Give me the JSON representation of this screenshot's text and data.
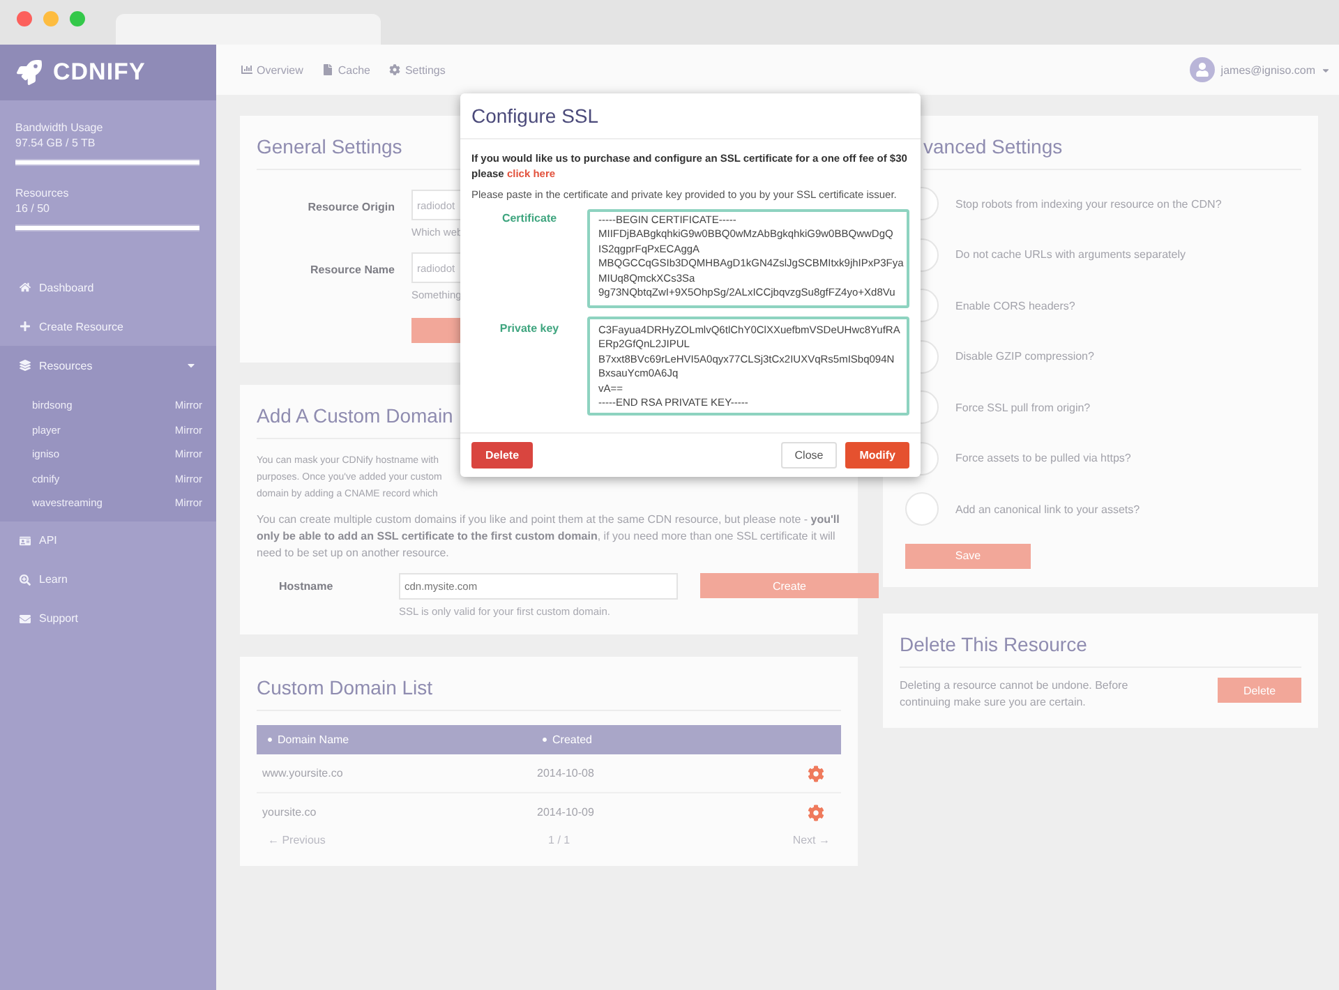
{
  "sidebar": {
    "logo": "CDNIFY",
    "meters": [
      {
        "label": "Bandwidth Usage",
        "reading": "97.54 GB / 5 TB",
        "level": 1
      },
      {
        "label": "Resources",
        "reading": "16 / 50",
        "level": 1
      }
    ],
    "items": [
      {
        "label": "Dashboard"
      },
      {
        "label": "Create Resource"
      },
      {
        "label": "Resources",
        "expanded": true,
        "children": [
          {
            "label": "birdsong",
            "badge": "Mirror"
          },
          {
            "label": "player",
            "badge": "Mirror"
          },
          {
            "label": "igniso",
            "badge": "Mirror"
          },
          {
            "label": "cdnify",
            "badge": "Mirror"
          },
          {
            "label": "wavestreaming",
            "badge": "Mirror"
          }
        ]
      },
      {
        "label": "API"
      },
      {
        "label": "Learn"
      },
      {
        "label": "Support"
      }
    ]
  },
  "topnav": {
    "tabs": [
      "Overview",
      "Cache",
      "Settings"
    ],
    "user": "james@igniso.com"
  },
  "general_settings": {
    "title": "General Settings",
    "fields": [
      {
        "label": "Resource Origin",
        "value": "radiodot",
        "hint": "Which web"
      },
      {
        "label": "Resource Name",
        "value": "radiodot",
        "hint": "Something"
      }
    ]
  },
  "custom_domain": {
    "title": "Add A Custom Domain",
    "lines": [
      "You can mask your CDNify hostname with",
      "purposes. Once you've added your custom",
      "domain by adding a CNAME record which"
    ],
    "note": "You can create multiple custom domains if you like and point them at the same CDN resource, but please note - **you'll only be able to add an SSL certificate to the first custom domain**, if you need more than one SSL certificate it will need to be set up on another resource.",
    "hostname": {
      "label": "Hostname",
      "placeholder": "cdn.mysite.com",
      "hint": "SSL is only valid for your first custom domain."
    },
    "button": "Create"
  },
  "domain_list": {
    "title": "Custom Domain List",
    "columns": [
      "Domain Name",
      "Created"
    ],
    "rows": [
      {
        "domain": "www.yoursite.co",
        "created": "2014-10-08"
      },
      {
        "domain": "yoursite.co",
        "created": "2014-10-09"
      }
    ],
    "pagination": {
      "previous": "← Previous",
      "page": "1 / 1",
      "next": "Next →"
    }
  },
  "advanced_settings": {
    "title": "vanced Settings",
    "options": [
      {
        "label": "Stop robots from indexing your resource on the CDN?",
        "on": false
      },
      {
        "label": "Do not cache URLs with arguments separately",
        "on": false
      },
      {
        "label": "Enable CORS headers?",
        "on": false
      },
      {
        "label": "Disable GZIP compression?",
        "on": false
      },
      {
        "label": "Force SSL pull from origin?",
        "on": false
      },
      {
        "label": "Force assets to be pulled via https?",
        "on": false
      },
      {
        "label": "Add an canonical link to your assets?",
        "on": false
      }
    ],
    "button": "Save"
  },
  "delete_resource": {
    "title": "Delete This Resource",
    "text": "Deleting a resource cannot be undone. Before continuing make sure you are certain.",
    "button": "Delete"
  },
  "modal": {
    "title": "Configure SSL",
    "intro": "If you would like us to purchase and configure an SSL certificate for a one off fee of $30 please",
    "link": "click here",
    "note": "Please paste in the certificate and private key provided to you by your SSL certificate issuer.",
    "fields": [
      {
        "label": "Certificate",
        "lines": [
          "-----BEGIN CERTIFICATE-----",
          "MIIFDjBABgkqhkiG9w0BBQ0wMzAbBgkqhkiG9w0BBQwwDgQ",
          "IS2qgprFqPxECAggA",
          "MBQGCCqGSIb3DQMHBAgD1kGN4ZslJgSCBMItxk9jhIPxP3Fya",
          "MIUq8QmckXCs3Sa",
          "9g73NQbtqZwI+9X5OhpSg/2ALxICCjbqvzgSu8gfFZ4yo+Xd8Vu"
        ]
      },
      {
        "label": "Private key",
        "lines": [
          "C3Fayua4DRHyZOLmlvQ6tlChY0ClXXuefbmVSDeUHwc8YufRA",
          "ERp2GfQnL2JIPUL",
          "B7xxt8BVc69rLeHVI5A0qyx77CLSj3tCx2IUXVqRs5mISbq094N",
          "BxsauYcm0A6Jq",
          "vA==",
          "-----END RSA PRIVATE KEY-----"
        ]
      }
    ],
    "buttons": [
      {
        "kind": "danger",
        "label": "Delete"
      },
      {
        "kind": "plain",
        "label": "Close"
      },
      {
        "kind": "primary",
        "label": "Modify"
      }
    ]
  }
}
